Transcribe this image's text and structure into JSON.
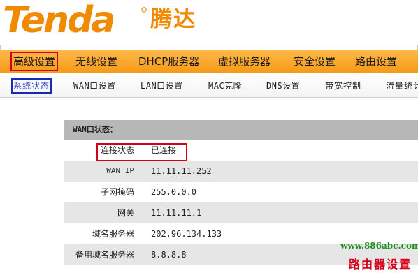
{
  "header": {
    "logo_text": "Tenda",
    "brand_cn": "腾达"
  },
  "main_nav": [
    {
      "label": "高级设置",
      "active": true
    },
    {
      "label": "无线设置",
      "active": false
    },
    {
      "label": "DHCP服务器",
      "active": false
    },
    {
      "label": "虚拟服务器",
      "active": false
    },
    {
      "label": "安全设置",
      "active": false
    },
    {
      "label": "路由设置",
      "active": false
    }
  ],
  "sub_nav": [
    {
      "label": "系统状态",
      "active": true
    },
    {
      "label": "WAN口设置",
      "active": false
    },
    {
      "label": "LAN口设置",
      "active": false
    },
    {
      "label": "MAC克隆",
      "active": false
    },
    {
      "label": "DNS设置",
      "active": false
    },
    {
      "label": "带宽控制",
      "active": false
    },
    {
      "label": "流量统计",
      "active": false
    }
  ],
  "wan_status": {
    "title": "WAN口状态：",
    "rows": [
      {
        "label": "连接状态",
        "value": "已连接"
      },
      {
        "label": "WAN IP",
        "value": "11.11.11.252"
      },
      {
        "label": "子网掩码",
        "value": "255.0.0.0"
      },
      {
        "label": "网关",
        "value": "11.11.11.1"
      },
      {
        "label": "域名服务器",
        "value": "202.96.134.133"
      },
      {
        "label": "备用域名服务器",
        "value": "8.8.8.8"
      }
    ]
  },
  "watermark": {
    "url": "www.886abc.com",
    "text": "路由器设置"
  },
  "colors": {
    "brand_orange": "#f08a00",
    "nav_orange": "#f59a18",
    "highlight_red": "#d4001a",
    "active_blue": "#1a2ab8"
  }
}
